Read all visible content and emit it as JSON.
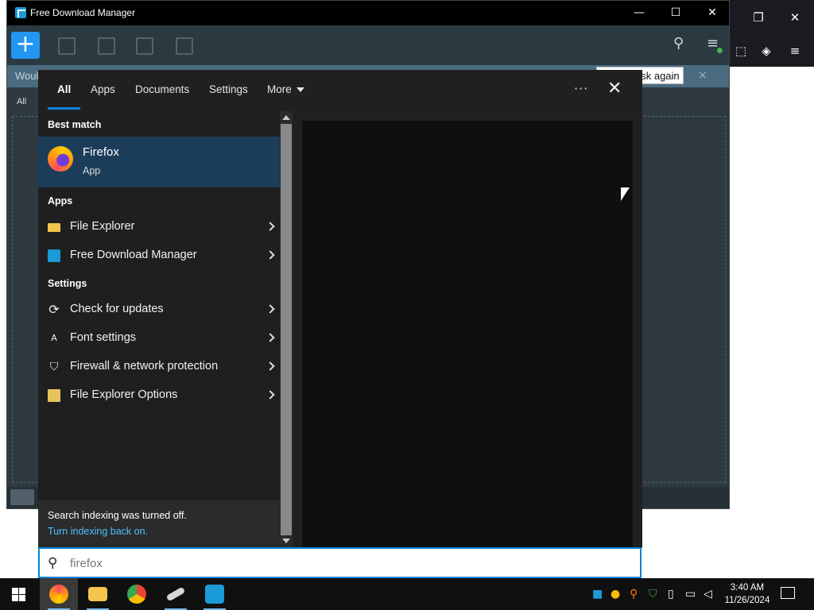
{
  "fdm_window": {
    "title": "Free Download Manager",
    "notice_text": "Woul",
    "ask_again_label": "ask again",
    "notice_close": "×",
    "filter_all": "All",
    "minimize": "—",
    "maximize": "☐",
    "close": "✕"
  },
  "firefox_window": {
    "restore": "❐",
    "close": "✕",
    "menu": "≡"
  },
  "search": {
    "tabs": [
      {
        "label": "All"
      },
      {
        "label": "Apps"
      },
      {
        "label": "Documents"
      },
      {
        "label": "Settings"
      },
      {
        "label": "More"
      }
    ],
    "dots_label": "···",
    "close_label": "✕",
    "best_match_header": "Best match",
    "best_match": {
      "name": "Firefox",
      "type": "App"
    },
    "apps_header": "Apps",
    "apps": [
      {
        "label": "File Explorer"
      },
      {
        "label": "Free Download Manager"
      }
    ],
    "settings_header": "Settings",
    "settings": [
      {
        "label": "Check for updates"
      },
      {
        "label": "Font settings"
      },
      {
        "label": "Firewall & network protection"
      },
      {
        "label": "File Explorer Options"
      }
    ],
    "index_notice": "Search indexing was turned off.",
    "index_link": "Turn indexing back on.",
    "query": "firefox"
  },
  "taskbar": {
    "time": "3:40 AM",
    "date": "11/26/2024"
  },
  "colors": {
    "accent": "#0a84d8",
    "best_match_bg": "#1c3d5a",
    "link": "#4cc2ff"
  }
}
